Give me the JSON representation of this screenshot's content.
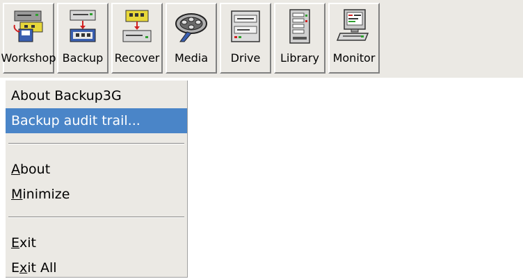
{
  "toolbar": {
    "buttons": [
      {
        "label": "Workshop",
        "icon": "workshop-icon"
      },
      {
        "label": "Backup",
        "icon": "backup-icon"
      },
      {
        "label": "Recover",
        "icon": "recover-icon"
      },
      {
        "label": "Media",
        "icon": "film-reel-icon"
      },
      {
        "label": "Drive",
        "icon": "drive-icon"
      },
      {
        "label": "Library",
        "icon": "library-icon"
      },
      {
        "label": "Monitor",
        "icon": "monitor-icon"
      }
    ]
  },
  "menu": {
    "about_product": "About Backup3G",
    "audit_trail": "Backup audit trail...",
    "about": {
      "mnemonic": "A",
      "rest": "bout"
    },
    "minimize": {
      "mnemonic": "M",
      "rest": "inimize"
    },
    "exit": {
      "mnemonic": "E",
      "rest": "xit"
    },
    "exit_all": {
      "pre": "E",
      "mnemonic": "x",
      "rest": "it All"
    }
  },
  "colors": {
    "menu_background": "#ebe9e4",
    "highlight": "#4a85c8",
    "highlight_text": "#ffffff"
  }
}
